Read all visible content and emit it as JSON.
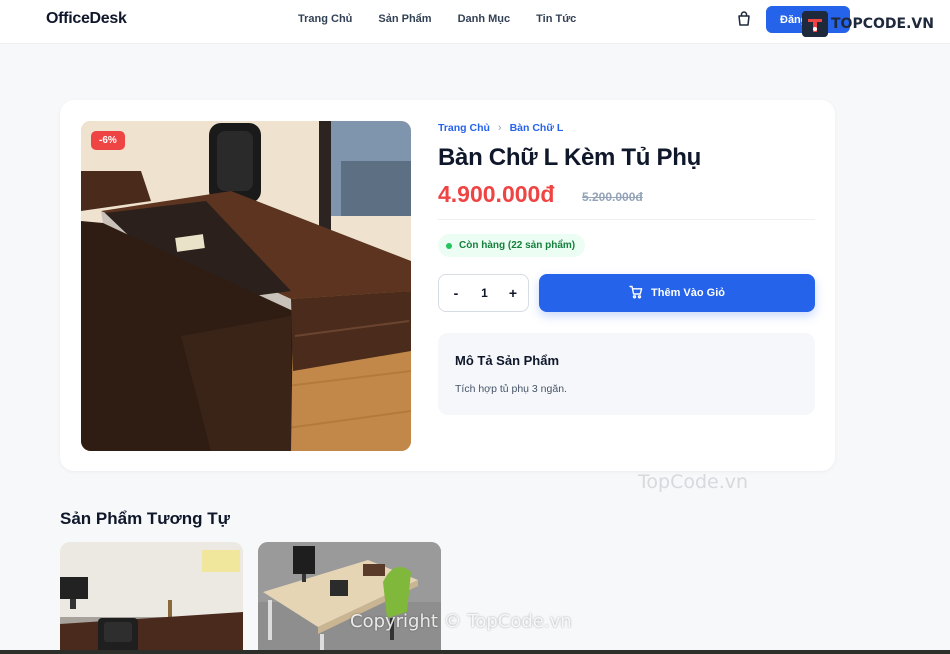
{
  "header": {
    "logo": "OfficeDesk",
    "nav": [
      "Trang Chủ",
      "Sản Phẩm",
      "Danh Mục",
      "Tin Tức"
    ],
    "cart_icon": "cart-icon",
    "login_label": "Đăng"
  },
  "watermarks": {
    "logo_text": "TOPCODE.VN",
    "center_text": "TopCode.vn",
    "copyright": "Copyright © TopCode.vn"
  },
  "product": {
    "discount_badge": "-6%",
    "breadcrumb": [
      "Trang Chủ",
      "Bàn Chữ L"
    ],
    "title": "Bàn Chữ L Kèm Tủ Phụ",
    "price": "4.900.000đ",
    "old_price": "5.200.000đ",
    "stock": "Còn hàng (22 sản phẩm)",
    "quantity": {
      "minus": "-",
      "value": "1",
      "plus": "+"
    },
    "add_to_cart": "Thêm Vào Giỏ",
    "description": {
      "title": "Mô Tả Sản Phẩm",
      "text": "Tích hợp tủ phụ 3 ngăn."
    }
  },
  "similar": {
    "title": "Sản Phẩm Tương Tự"
  },
  "colors": {
    "primary": "#2563eb",
    "price_red": "#ef4444",
    "stock_green": "#15803d"
  }
}
